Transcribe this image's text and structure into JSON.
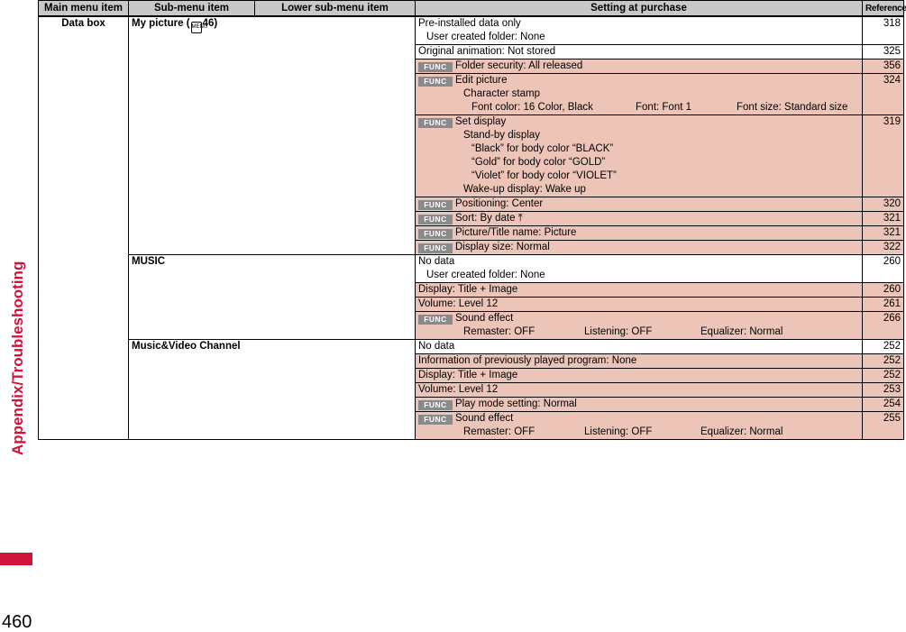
{
  "side_tab": {
    "label": "Appendix/Troubleshooting"
  },
  "page_number": "460",
  "table": {
    "headers": {
      "main": "Main menu item",
      "sub": "Sub-menu item",
      "lower": "Lower sub-menu item",
      "setting": "Setting at purchase",
      "ref": "Reference"
    },
    "main_item": "Data box",
    "func_label": "FUNC",
    "my_picture": {
      "label": "My picture (",
      "page": "46)",
      "rows": [
        {
          "lines": [
            "Pre-installed data only",
            "User created folder: None"
          ],
          "ref": "318"
        },
        {
          "lines": [
            "Original animation: Not stored"
          ],
          "ref": "325"
        },
        {
          "lines": [
            "Folder security: All released"
          ],
          "ref": "356"
        },
        {
          "lines": [
            "Edit picture",
            "Character stamp"
          ],
          "cols": [
            "Font color: 16 Color, Black",
            "Font: Font 1",
            "Font size: Standard size"
          ],
          "ref": "324"
        },
        {
          "lines": [
            "Set display",
            "Stand-by display",
            "“Black” for body color “BLACK”",
            "“Gold” for body color “GOLD”",
            "“Violet” for body color “VIOLET”",
            "Wake-up display: Wake up"
          ],
          "ref": "319"
        },
        {
          "lines": [
            "Positioning: Center"
          ],
          "ref": "320"
        },
        {
          "lines": [
            "Sort: By date ⤒"
          ],
          "ref": "321"
        },
        {
          "lines": [
            "Picture/Title name: Picture"
          ],
          "ref": "321"
        },
        {
          "lines": [
            "Display size: Normal"
          ],
          "ref": "322"
        }
      ]
    },
    "music": {
      "label": "MUSIC",
      "rows": [
        {
          "lines": [
            "No data",
            "User created folder: None"
          ],
          "ref": "260"
        },
        {
          "lines": [
            "Display: Title + Image"
          ],
          "ref": "260"
        },
        {
          "lines": [
            "Volume: Level 12"
          ],
          "ref": "261"
        },
        {
          "lines": [
            "Sound effect"
          ],
          "cols": [
            "Remaster: OFF",
            "Listening: OFF",
            "Equalizer: Normal"
          ],
          "ref": "266"
        }
      ]
    },
    "mvc": {
      "label": "Music&Video Channel",
      "rows": [
        {
          "lines": [
            "No data"
          ],
          "ref": "252"
        },
        {
          "lines": [
            "Information of previously played program: None"
          ],
          "ref": "252"
        },
        {
          "lines": [
            "Display: Title + Image"
          ],
          "ref": "252"
        },
        {
          "lines": [
            "Volume: Level 12"
          ],
          "ref": "253"
        },
        {
          "lines": [
            "Play mode setting: Normal"
          ],
          "ref": "254"
        },
        {
          "lines": [
            "Sound effect"
          ],
          "cols": [
            "Remaster: OFF",
            "Listening: OFF",
            "Equalizer: Normal"
          ],
          "ref": "255"
        }
      ]
    }
  }
}
